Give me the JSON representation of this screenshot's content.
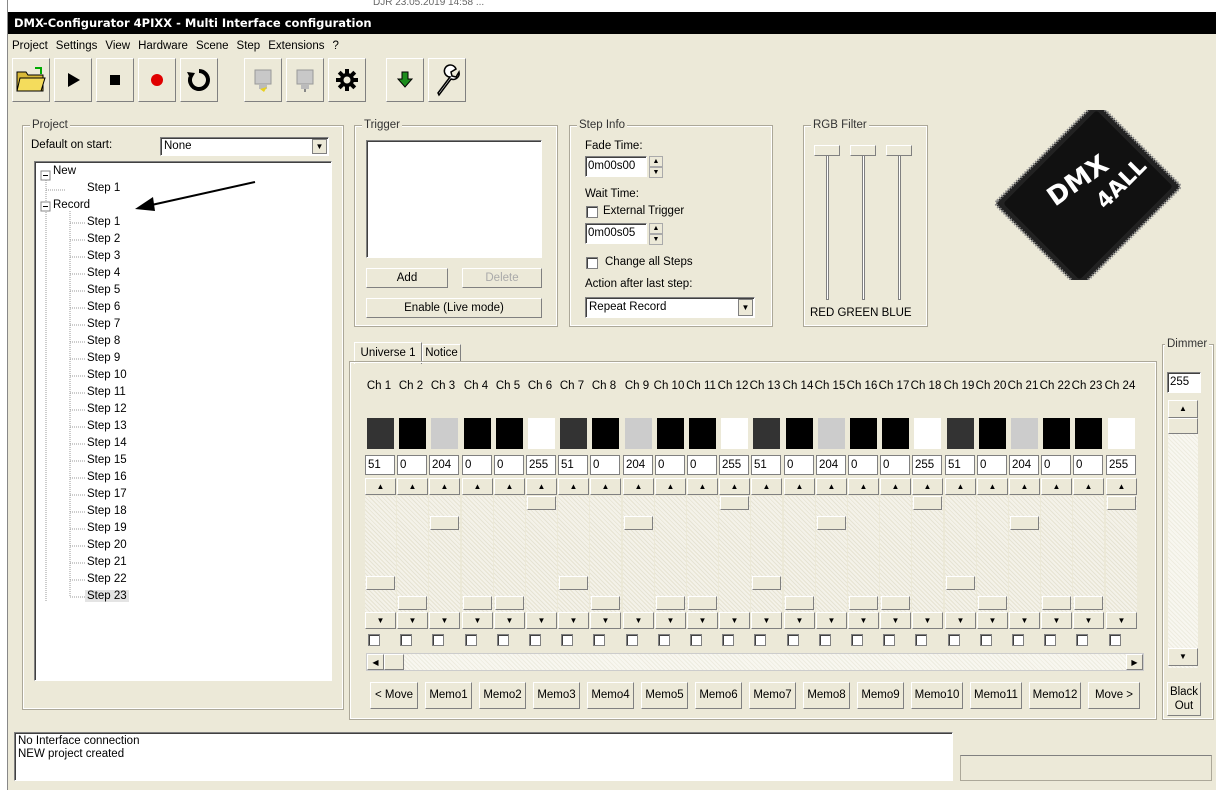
{
  "window": {
    "title": "DMX-Configurator 4PIXX - Multi Interface configuration",
    "top_strip_text": "DJR      23.05.2019 14:58        ..."
  },
  "menu": [
    "Project",
    "Settings",
    "View",
    "Hardware",
    "Scene",
    "Step",
    "Extensions",
    "?"
  ],
  "toolbar_icons": [
    "open-folder-icon",
    "play-icon",
    "stop-icon",
    "record-icon",
    "reload-icon",
    "interface-plug-icon",
    "interface-plug-disabled-icon",
    "gear-icon",
    "download-icon",
    "wrench-icon"
  ],
  "project": {
    "group_label": "Project",
    "default_label": "Default on start:",
    "default_value": "None",
    "tree": {
      "node1": "New",
      "node1_children": [
        "Step 1"
      ],
      "node2": "Record",
      "node2_children": [
        "Step 1",
        "Step 2",
        "Step 3",
        "Step 4",
        "Step 5",
        "Step 6",
        "Step 7",
        "Step 8",
        "Step 9",
        "Step 10",
        "Step 11",
        "Step 12",
        "Step 13",
        "Step 14",
        "Step 15",
        "Step 16",
        "Step 17",
        "Step 18",
        "Step 19",
        "Step 20",
        "Step 21",
        "Step 22",
        "Step 23"
      ]
    }
  },
  "trigger": {
    "group_label": "Trigger",
    "add": "Add",
    "delete": "Delete",
    "enable": "Enable (Live mode)"
  },
  "step_info": {
    "group_label": "Step Info",
    "fade_label": "Fade Time:",
    "fade_value": "0m00s00",
    "wait_label": "Wait Time:",
    "external_trigger": "External Trigger",
    "wait_value": "0m00s05",
    "change_all": "Change all Steps",
    "action_label": "Action after last step:",
    "action_value": "Repeat Record"
  },
  "rgb_filter": {
    "group_label": "RGB Filter",
    "labels": "RED GREEN BLUE"
  },
  "logo": {
    "line1": "DMX",
    "line2": "4ALL"
  },
  "tabs": [
    "Universe 1",
    "Notice"
  ],
  "channels": [
    {
      "label": "Ch 1",
      "value": "51",
      "color": "#333333"
    },
    {
      "label": "Ch 2",
      "value": "0",
      "color": "#000000"
    },
    {
      "label": "Ch 3",
      "value": "204",
      "color": "#cccccc"
    },
    {
      "label": "Ch 4",
      "value": "0",
      "color": "#000000"
    },
    {
      "label": "Ch 5",
      "value": "0",
      "color": "#000000"
    },
    {
      "label": "Ch 6",
      "value": "255",
      "color": "#ffffff"
    },
    {
      "label": "Ch 7",
      "value": "51",
      "color": "#333333"
    },
    {
      "label": "Ch 8",
      "value": "0",
      "color": "#000000"
    },
    {
      "label": "Ch 9",
      "value": "204",
      "color": "#cccccc"
    },
    {
      "label": "Ch 10",
      "value": "0",
      "color": "#000000"
    },
    {
      "label": "Ch 11",
      "value": "0",
      "color": "#000000"
    },
    {
      "label": "Ch 12",
      "value": "255",
      "color": "#ffffff"
    },
    {
      "label": "Ch 13",
      "value": "51",
      "color": "#333333"
    },
    {
      "label": "Ch 14",
      "value": "0",
      "color": "#000000"
    },
    {
      "label": "Ch 15",
      "value": "204",
      "color": "#cccccc"
    },
    {
      "label": "Ch 16",
      "value": "0",
      "color": "#000000"
    },
    {
      "label": "Ch 17",
      "value": "0",
      "color": "#000000"
    },
    {
      "label": "Ch 18",
      "value": "255",
      "color": "#ffffff"
    },
    {
      "label": "Ch 19",
      "value": "51",
      "color": "#333333"
    },
    {
      "label": "Ch 20",
      "value": "0",
      "color": "#000000"
    },
    {
      "label": "Ch 21",
      "value": "204",
      "color": "#cccccc"
    },
    {
      "label": "Ch 22",
      "value": "0",
      "color": "#000000"
    },
    {
      "label": "Ch 23",
      "value": "0",
      "color": "#000000"
    },
    {
      "label": "Ch 24",
      "value": "255",
      "color": "#ffffff"
    }
  ],
  "memos": [
    "< Move",
    "Memo1",
    "Memo2",
    "Memo3",
    "Memo4",
    "Memo5",
    "Memo6",
    "Memo7",
    "Memo8",
    "Memo9",
    "Memo10",
    "Memo11",
    "Memo12",
    "Move >"
  ],
  "dimmer": {
    "label": "Dimmer",
    "value": "255",
    "blackout": "Black Out"
  },
  "status": {
    "lines": [
      "No Interface connection",
      "NEW project created"
    ]
  }
}
